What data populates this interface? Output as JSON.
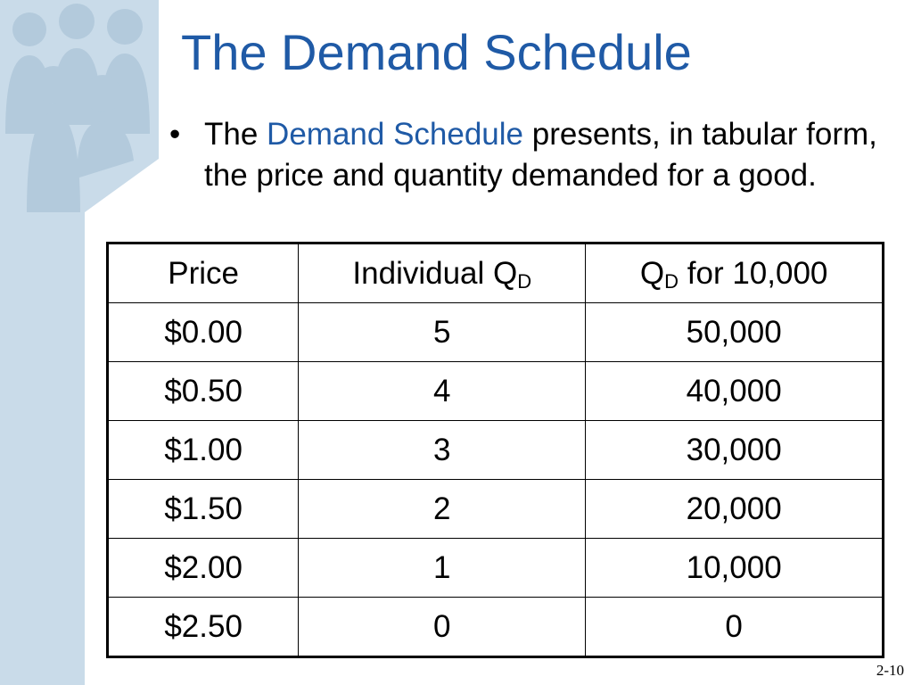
{
  "slide": {
    "title": "The Demand Schedule",
    "bullet": {
      "lead": "The ",
      "highlight": "Demand Schedule",
      "rest": " presents, in tabular form, the price and quantity demanded for a good."
    },
    "table": {
      "headers": [
        {
          "main": "Price",
          "sub": "",
          "tail": ""
        },
        {
          "main": "Individual Q",
          "sub": "D",
          "tail": ""
        },
        {
          "main": "Q",
          "sub": "D",
          "tail": " for 10,000"
        }
      ],
      "rows": [
        [
          "$0.00",
          "5",
          "50,000"
        ],
        [
          "$0.50",
          "4",
          "40,000"
        ],
        [
          "$1.00",
          "3",
          "30,000"
        ],
        [
          "$1.50",
          "2",
          "20,000"
        ],
        [
          "$2.00",
          "1",
          "10,000"
        ],
        [
          "$2.50",
          "0",
          "0"
        ]
      ]
    },
    "slide_number": "2-10"
  },
  "colors": {
    "title": "#1f5aa6",
    "highlight": "#1f5aa6",
    "panel": "#c9dbe9",
    "silhouette": "#b3cadc"
  },
  "icons": [
    "people-silhouette-icon"
  ]
}
